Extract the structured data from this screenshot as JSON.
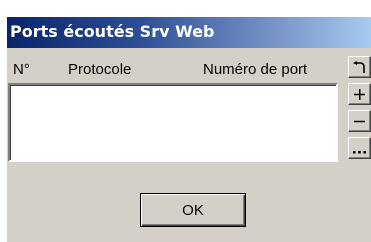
{
  "window": {
    "title": "Ports écoutés Srv Web"
  },
  "list": {
    "columns": [
      "N°",
      "Protocole",
      "Numéro de port"
    ],
    "rows": []
  },
  "side_buttons": {
    "undo_icon": "undo-arrow-icon",
    "add_label": "+",
    "remove_label": "–",
    "more_label": "..."
  },
  "footer": {
    "ok_label": "OK"
  },
  "colors": {
    "titlebar_start": "#0a246a",
    "titlebar_end": "#a6caf0",
    "dialog_bg": "#d4d0c8"
  }
}
